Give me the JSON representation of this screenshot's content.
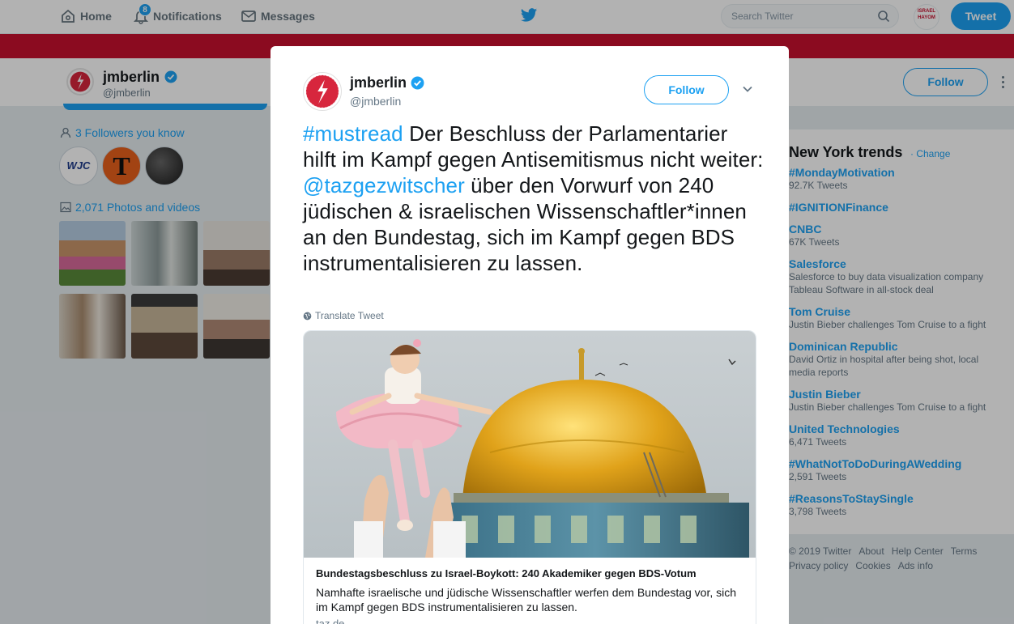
{
  "topnav": {
    "home_label": "Home",
    "notifications_label": "Notifications",
    "notifications_count": "8",
    "messages_label": "Messages",
    "search_placeholder": "Search Twitter",
    "tweet_button": "Tweet",
    "avatar_text": "ISRAEL HAYOM"
  },
  "profile_header": {
    "name": "jmberlin",
    "handle": "@jmberlin",
    "follow_label": "Follow"
  },
  "sidebar": {
    "followers_you_know": "3 Followers you know",
    "follower_avatars": [
      "WJC",
      "T",
      ""
    ],
    "photos_label": "2,071 Photos and videos"
  },
  "trends": {
    "title": "New York trends",
    "change_label": "· Change",
    "items": [
      {
        "name": "#MondayMotivation",
        "sub": "92.7K Tweets"
      },
      {
        "name": "#IGNITIONFinance",
        "sub": ""
      },
      {
        "name": "CNBC",
        "sub": "67K Tweets"
      },
      {
        "name": "Salesforce",
        "sub": "Salesforce to buy data visualization company Tableau Software in all-stock deal"
      },
      {
        "name": "Tom Cruise",
        "sub": "Justin Bieber challenges Tom Cruise to a fight"
      },
      {
        "name": "Dominican Republic",
        "sub": "David Ortiz in hospital after being shot, local media reports"
      },
      {
        "name": "Justin Bieber",
        "sub": "Justin Bieber challenges Tom Cruise to a fight"
      },
      {
        "name": "United Technologies",
        "sub": "6,471 Tweets"
      },
      {
        "name": "#WhatNotToDoDuringAWedding",
        "sub": "2,591 Tweets"
      },
      {
        "name": "#ReasonsToStaySingle",
        "sub": "3,798 Tweets"
      }
    ]
  },
  "footer": {
    "links": [
      "© 2019 Twitter",
      "About",
      "Help Center",
      "Terms",
      "Privacy policy",
      "Cookies",
      "Ads info"
    ]
  },
  "modal": {
    "name": "jmberlin",
    "handle": "@jmberlin",
    "follow_label": "Follow",
    "tweet": {
      "hashtag": "#mustread",
      "text_1": " Der Beschluss der Parlamentarier hilft im Kampf gegen Antisemitismus nicht weiter: ",
      "mention": "@tazgezwitscher",
      "text_2": " über den Vorwurf von 240 jüdischen & israelischen Wissenschaftler*innen an den Bundestag, sich im Kampf gegen BDS instrumentalisieren zu lassen."
    },
    "translate_label": "Translate Tweet",
    "card": {
      "title": "Bundestagsbeschluss zu Israel-Boykott: 240 Akademiker gegen BDS-Votum",
      "description": "Namhafte israelische und jüdische Wissenschaftler werfen dem Bundestag vor, sich im Kampf gegen BDS instrumentalisieren zu lassen.",
      "domain": "taz.de"
    }
  },
  "colors": {
    "accent": "#1da1f2",
    "banner": "#c8102e",
    "background": "#e6ecf0"
  }
}
